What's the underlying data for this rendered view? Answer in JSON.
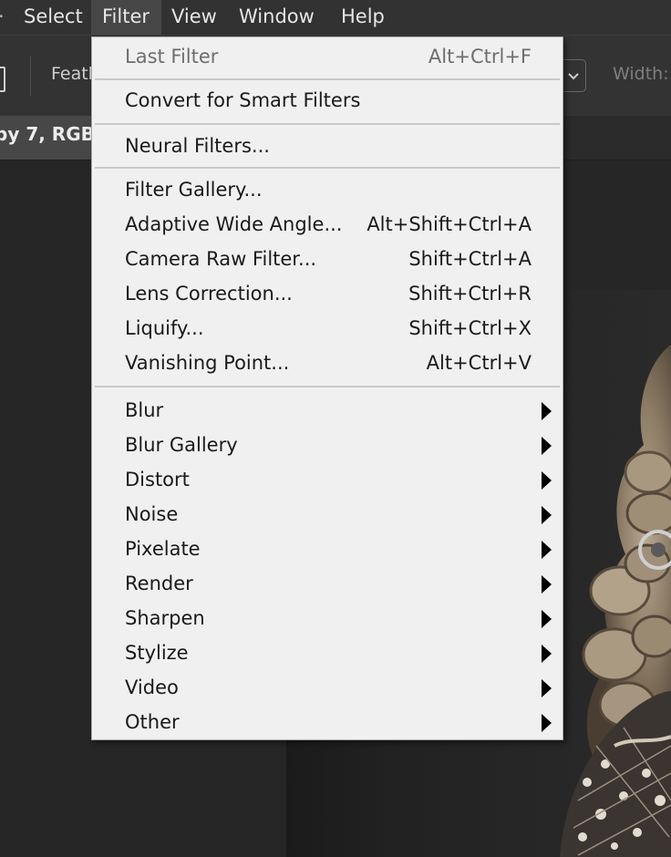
{
  "menubar": {
    "items": [
      {
        "label": "Select"
      },
      {
        "label": "Filter"
      },
      {
        "label": "View"
      },
      {
        "label": "Window"
      },
      {
        "label": "Help"
      }
    ],
    "active": "Filter"
  },
  "options_bar": {
    "feather_label": "Feath",
    "width_label": "Width:"
  },
  "document": {
    "tab_title": "py 7, RGB/"
  },
  "filter_menu": {
    "last_filter": {
      "label": "Last Filter",
      "shortcut": "Alt+Ctrl+F",
      "enabled": false
    },
    "convert_smart": {
      "label": "Convert for Smart Filters"
    },
    "neural_filters": {
      "label": "Neural Filters..."
    },
    "filter_gallery": {
      "label": "Filter Gallery..."
    },
    "adaptive_wide_angle": {
      "label": "Adaptive Wide Angle...",
      "shortcut": "Alt+Shift+Ctrl+A"
    },
    "camera_raw": {
      "label": "Camera Raw Filter...",
      "shortcut": "Shift+Ctrl+A"
    },
    "lens_correction": {
      "label": "Lens Correction...",
      "shortcut": "Shift+Ctrl+R"
    },
    "liquify": {
      "label": "Liquify...",
      "shortcut": "Shift+Ctrl+X"
    },
    "vanishing_point": {
      "label": "Vanishing Point...",
      "shortcut": "Alt+Ctrl+V"
    },
    "submenus": [
      {
        "label": "Blur"
      },
      {
        "label": "Blur Gallery"
      },
      {
        "label": "Distort"
      },
      {
        "label": "Noise"
      },
      {
        "label": "Pixelate"
      },
      {
        "label": "Render"
      },
      {
        "label": "Sharpen"
      },
      {
        "label": "Stylize"
      },
      {
        "label": "Video"
      },
      {
        "label": "Other"
      }
    ]
  },
  "colors": {
    "menubar_bg": "#323232",
    "menu_bg": "#f0f0f0",
    "workspace_bg": "#262626"
  }
}
